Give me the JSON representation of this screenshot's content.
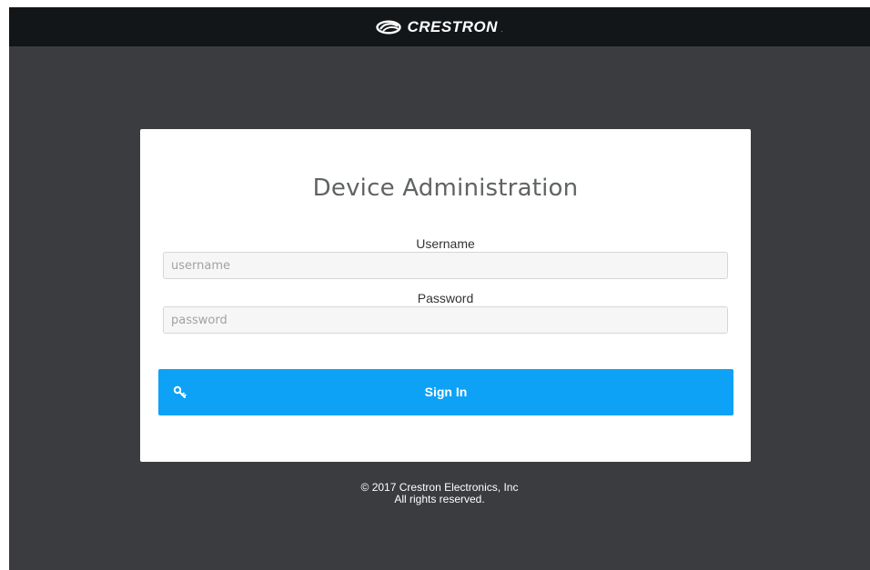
{
  "header": {
    "brand": "CRESTRON",
    "brand_mark": "."
  },
  "login": {
    "title": "Device Administration",
    "username_label": "Username",
    "username_placeholder": "username",
    "password_label": "Password",
    "password_placeholder": "password",
    "signin_label": "Sign In",
    "signin_icon": "key-icon"
  },
  "footer": {
    "copyright": "© 2017 Crestron Electronics, Inc",
    "rights": "All rights reserved."
  },
  "colors": {
    "topbar": "#131619",
    "background": "#3a3c3f",
    "card": "#ffffff",
    "primary_button": "#0ea2f6"
  }
}
